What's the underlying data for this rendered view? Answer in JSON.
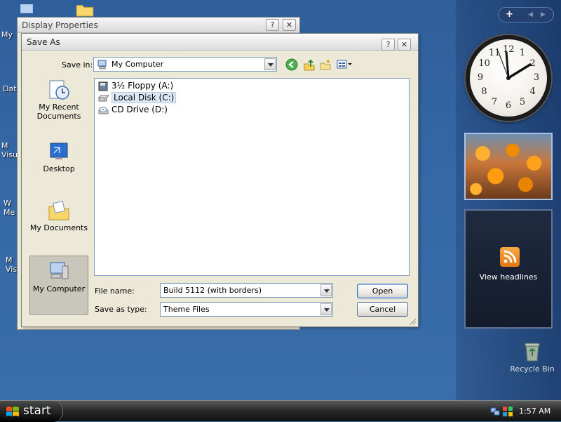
{
  "desktop": {
    "icons": [
      {
        "label": "My"
      },
      {
        "label": "Dat"
      },
      {
        "label": "M\nVisu"
      },
      {
        "label": "W\nMe"
      },
      {
        "label": "M\nVis"
      }
    ],
    "recycle_bin": "Recycle Bin"
  },
  "sidebar": {
    "add_button": "+",
    "clock_numbers": [
      "12",
      "1",
      "2",
      "3",
      "4",
      "5",
      "6",
      "7",
      "8",
      "9",
      "10",
      "11"
    ],
    "feed_label": "View headlines"
  },
  "display_properties": {
    "title": "Display Properties",
    "help": "?",
    "close": "✕"
  },
  "save_as": {
    "title": "Save As",
    "help": "?",
    "close": "✕",
    "save_in_label": "Save in:",
    "save_in_value": "My Computer",
    "places": [
      {
        "label": "My Recent Documents",
        "icon": "recent-documents-icon"
      },
      {
        "label": "Desktop",
        "icon": "desktop-icon"
      },
      {
        "label": "My Documents",
        "icon": "my-documents-icon"
      },
      {
        "label": "My Computer",
        "icon": "my-computer-icon"
      }
    ],
    "files": [
      {
        "name": "3½ Floppy (A:)",
        "icon": "floppy-drive-icon"
      },
      {
        "name": "Local Disk (C:)",
        "icon": "hard-disk-icon"
      },
      {
        "name": "CD Drive (D:)",
        "icon": "cd-drive-icon"
      }
    ],
    "file_name_label": "File name:",
    "file_name_value": "Build 5112 (with borders)",
    "save_type_label": "Save as type:",
    "save_type_value": "Theme Files",
    "open_button": "Open",
    "cancel_button": "Cancel"
  },
  "taskbar": {
    "start_label": "start",
    "time": "1:57 AM"
  },
  "colors": {
    "desktop": "#3a6ea5",
    "dialog": "#ece9d8",
    "selection": "#dde8f5"
  }
}
